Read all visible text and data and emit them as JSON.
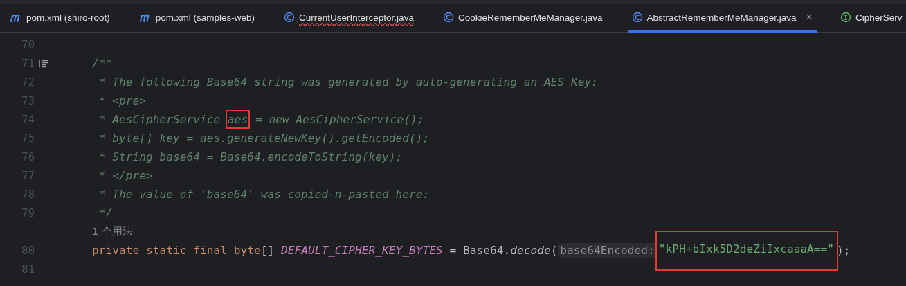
{
  "tabs": [
    {
      "label": "pom.xml (shiro-root)",
      "kind": "maven",
      "selected": false,
      "error": false
    },
    {
      "label": "pom.xml (samples-web)",
      "kind": "maven",
      "selected": false,
      "error": false
    },
    {
      "label": "CurrentUserInterceptor.java",
      "kind": "class",
      "selected": false,
      "error": true
    },
    {
      "label": "CookieRememberMeManager.java",
      "kind": "class",
      "selected": false,
      "error": false
    },
    {
      "label": "AbstractRememberMeManager.java",
      "kind": "class",
      "selected": true,
      "error": false,
      "close": "×"
    },
    {
      "label": "CipherServ",
      "kind": "interface",
      "selected": false,
      "error": false
    }
  ],
  "lines": [
    {
      "kind": "code",
      "number": "70"
    },
    {
      "kind": "code",
      "number": "71",
      "doc_icon": true,
      "tokens": [
        {
          "kind": "comment",
          "text": "/**"
        }
      ]
    },
    {
      "kind": "code",
      "number": "72",
      "tokens": [
        {
          "kind": "comment",
          "text": " * The following Base64 string was generated by auto-generating an AES Key:"
        }
      ]
    },
    {
      "kind": "code",
      "number": "73",
      "tokens": [
        {
          "kind": "comment",
          "text": " * <pre>"
        }
      ]
    },
    {
      "kind": "code",
      "number": "74",
      "tokens": [
        {
          "kind": "comment",
          "text": " * AesCipherService "
        },
        {
          "kind": "comment",
          "text": "aes",
          "highlighted": true
        },
        {
          "kind": "comment",
          "text": " = new AesCipherService();"
        }
      ]
    },
    {
      "kind": "code",
      "number": "75",
      "tokens": [
        {
          "kind": "comment",
          "text": " * byte[] key = aes.generateNewKey().getEncoded();"
        }
      ]
    },
    {
      "kind": "code",
      "number": "76",
      "tokens": [
        {
          "kind": "comment",
          "text": " * String base64 = Base64.encodeToString(key);"
        }
      ]
    },
    {
      "kind": "code",
      "number": "77",
      "tokens": [
        {
          "kind": "comment",
          "text": " * </pre>"
        }
      ]
    },
    {
      "kind": "code",
      "number": "78",
      "tokens": [
        {
          "kind": "comment",
          "text": " * The value of 'base64' was copied-n-pasted here:"
        }
      ]
    },
    {
      "kind": "code",
      "number": "79",
      "tokens": [
        {
          "kind": "comment",
          "text": " */"
        }
      ]
    },
    {
      "kind": "usage_hint",
      "text": "1 个用法"
    },
    {
      "kind": "code",
      "number": "80",
      "tokens": [
        {
          "kind": "keyword",
          "text": "private static final byte"
        },
        {
          "kind": "plain",
          "text": "[] "
        },
        {
          "kind": "constant",
          "text": "DEFAULT_CIPHER_KEY_BYTES"
        },
        {
          "kind": "plain",
          "text": " = Base64."
        },
        {
          "kind": "method",
          "text": "decode"
        },
        {
          "kind": "plain",
          "text": "( "
        },
        {
          "kind": "hint",
          "text": "base64Encoded:"
        },
        {
          "kind": "string",
          "text": "\"kPH+bIxk5D2deZiIxcaaaA==\"",
          "highlighted": true
        },
        {
          "kind": "plain",
          "text": ");"
        }
      ]
    },
    {
      "kind": "code",
      "number": "81"
    }
  ]
}
